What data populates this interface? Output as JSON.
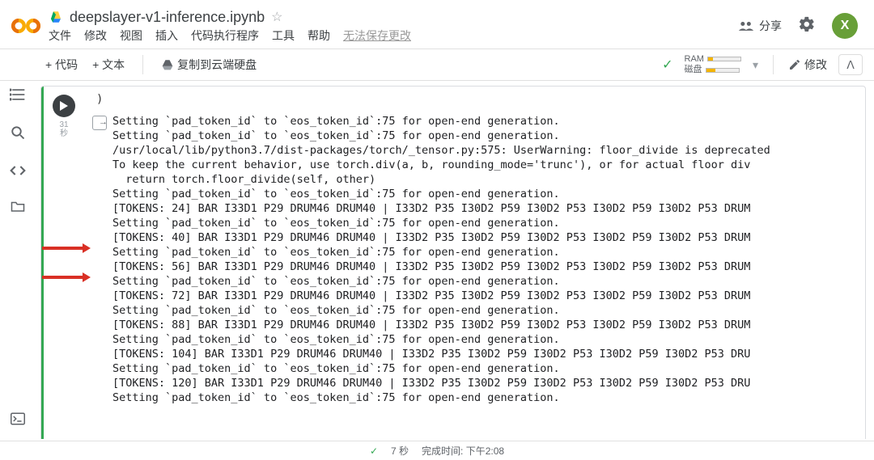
{
  "header": {
    "notebook_title": "deepslayer-v1-inference.ipynb",
    "menu": {
      "file": "文件",
      "edit": "修改",
      "view": "视图",
      "insert": "插入",
      "runtime": "代码执行程序",
      "tools": "工具",
      "help": "帮助",
      "disabled": "无法保存更改"
    },
    "share": "分享",
    "avatar_letter": "X"
  },
  "toolbar": {
    "add_code": "+ 代码",
    "add_text": "+ 文本",
    "copy_to_drive": "复制到云端硬盘",
    "ram_label": "RAM",
    "disk_label": "磁盘",
    "edit_label": "修改"
  },
  "cell": {
    "exec_seconds": "31",
    "exec_unit": "秒",
    "code_visible": ")"
  },
  "output_lines": [
    "Setting `pad_token_id` to `eos_token_id`:75 for open-end generation.",
    "Setting `pad_token_id` to `eos_token_id`:75 for open-end generation.",
    "/usr/local/lib/python3.7/dist-packages/torch/_tensor.py:575: UserWarning: floor_divide is deprecated",
    "To keep the current behavior, use torch.div(a, b, rounding_mode='trunc'), or for actual floor div",
    "  return torch.floor_divide(self, other)",
    "Setting `pad_token_id` to `eos_token_id`:75 for open-end generation.",
    "[TOKENS: 24] BAR I33D1 P29 DRUM46 DRUM40 | I33D2 P35 I30D2 P59 I30D2 P53 I30D2 P59 I30D2 P53 DRUM",
    "Setting `pad_token_id` to `eos_token_id`:75 for open-end generation.",
    "[TOKENS: 40] BAR I33D1 P29 DRUM46 DRUM40 | I33D2 P35 I30D2 P59 I30D2 P53 I30D2 P59 I30D2 P53 DRUM",
    "Setting `pad_token_id` to `eos_token_id`:75 for open-end generation.",
    "[TOKENS: 56] BAR I33D1 P29 DRUM46 DRUM40 | I33D2 P35 I30D2 P59 I30D2 P53 I30D2 P59 I30D2 P53 DRUM",
    "Setting `pad_token_id` to `eos_token_id`:75 for open-end generation.",
    "[TOKENS: 72] BAR I33D1 P29 DRUM46 DRUM40 | I33D2 P35 I30D2 P59 I30D2 P53 I30D2 P59 I30D2 P53 DRUM",
    "Setting `pad_token_id` to `eos_token_id`:75 for open-end generation.",
    "[TOKENS: 88] BAR I33D1 P29 DRUM46 DRUM40 | I33D2 P35 I30D2 P59 I30D2 P53 I30D2 P59 I30D2 P53 DRUM",
    "Setting `pad_token_id` to `eos_token_id`:75 for open-end generation.",
    "[TOKENS: 104] BAR I33D1 P29 DRUM46 DRUM40 | I33D2 P35 I30D2 P59 I30D2 P53 I30D2 P59 I30D2 P53 DRU",
    "Setting `pad_token_id` to `eos_token_id`:75 for open-end generation.",
    "[TOKENS: 120] BAR I33D1 P29 DRUM46 DRUM40 | I33D2 P35 I30D2 P59 I30D2 P53 I30D2 P59 I30D2 P53 DRU",
    "Setting `pad_token_id` to `eos_token_id`:75 for open-end generation."
  ],
  "footer": {
    "runtime": "7 秒",
    "completed_label": "完成时间:",
    "completed_time": "下午2:08"
  }
}
